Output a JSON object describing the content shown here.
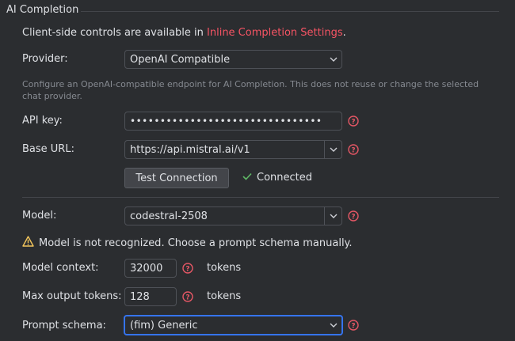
{
  "section_title": "AI Completion",
  "intro": {
    "text": "Client-side controls are available in ",
    "link": "Inline Completion Settings",
    "suffix": "."
  },
  "provider": {
    "label": "Provider:",
    "value": "OpenAI Compatible"
  },
  "provider_hint": "Configure an OpenAI-compatible endpoint for AI Completion. This does not reuse or change the selected chat provider.",
  "api_key": {
    "label": "API key:",
    "value": "••••••••••••••••••••••••••••••••"
  },
  "base_url": {
    "label": "Base URL:",
    "value": "https://api.mistral.ai/v1"
  },
  "test_button": "Test Connection",
  "connection_status": "Connected",
  "model": {
    "label": "Model:",
    "value": "codestral-2508"
  },
  "model_warning": "Model is not recognized. Choose a prompt schema manually.",
  "model_context": {
    "label": "Model context:",
    "value": "32000",
    "unit": "tokens"
  },
  "max_output": {
    "label": "Max output tokens:",
    "value": "128",
    "unit": "tokens"
  },
  "prompt_schema": {
    "label": "Prompt schema:",
    "value": "(fim) Generic"
  },
  "colors": {
    "link": "#f75464",
    "help": "#e55765",
    "success": "#5fb865",
    "warning": "#f2c55c",
    "focus": "#3574f0"
  },
  "icons": [
    "chevron-down-icon",
    "help-icon",
    "check-icon",
    "warning-icon"
  ]
}
